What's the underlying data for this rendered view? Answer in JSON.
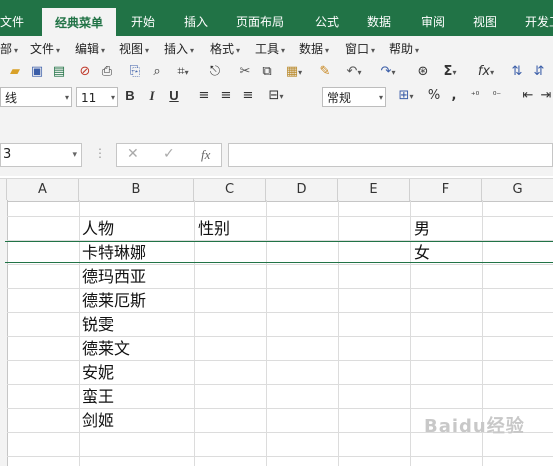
{
  "ribbon": {
    "tabs": [
      {
        "label": "文件"
      },
      {
        "label": "经典菜单"
      },
      {
        "label": "开始"
      },
      {
        "label": "插入"
      },
      {
        "label": "页面布局"
      },
      {
        "label": "公式"
      },
      {
        "label": "数据"
      },
      {
        "label": "审阅"
      },
      {
        "label": "视图"
      },
      {
        "label": "开发工"
      }
    ]
  },
  "menus": [
    {
      "label": "部"
    },
    {
      "label": "文件"
    },
    {
      "label": "编辑"
    },
    {
      "label": "视图"
    },
    {
      "label": "插入"
    },
    {
      "label": "格式"
    },
    {
      "label": "工具"
    },
    {
      "label": "数据"
    },
    {
      "label": "窗口"
    },
    {
      "label": "帮助"
    }
  ],
  "toolbar": {
    "font_name": "线",
    "font_size": "11",
    "bold": "B",
    "italic": "I",
    "underline": "U",
    "number_format": "常规",
    "percent": "%",
    "comma": ",",
    "sum": "Σ",
    "fx": "fx"
  },
  "formula_bar": {
    "name_box": "3",
    "fx_label": "fx",
    "cancel": "✕",
    "confirm": "✓",
    "content": ""
  },
  "columns": [
    "A",
    "B",
    "C",
    "D",
    "E",
    "F",
    "G"
  ],
  "cells": {
    "B1": "人物",
    "C1": "性别",
    "F1": "男",
    "F2": "女",
    "B2": "卡特琳娜",
    "B3": "德玛西亚",
    "B4": "德莱厄斯",
    "B5": "锐雯",
    "B6": "德莱文",
    "B7": "安妮",
    "B8": "蛮王",
    "B9": "剑姬"
  },
  "watermark": "Baidu经验"
}
